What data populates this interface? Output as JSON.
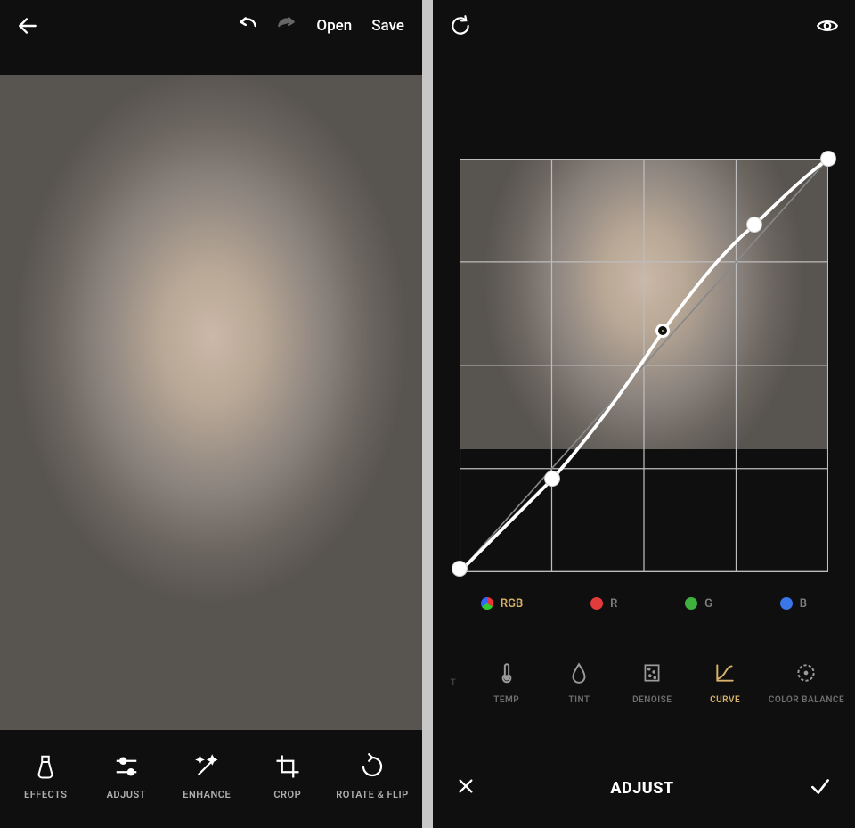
{
  "left": {
    "toolbar": {
      "open_label": "Open",
      "save_label": "Save"
    },
    "tools": [
      {
        "id": "effects",
        "label": "EFFECTS"
      },
      {
        "id": "adjust",
        "label": "ADJUST"
      },
      {
        "id": "enhance",
        "label": "ENHANCE"
      },
      {
        "id": "crop",
        "label": "CROP"
      },
      {
        "id": "rotate",
        "label": "ROTATE & FLIP"
      }
    ]
  },
  "right": {
    "curve_points": [
      {
        "x": 0.0,
        "y": 1.0
      },
      {
        "x": 0.25,
        "y": 0.78
      },
      {
        "x": 0.55,
        "y": 0.42,
        "selected": true
      },
      {
        "x": 0.8,
        "y": 0.16
      },
      {
        "x": 1.0,
        "y": 0.0
      }
    ],
    "channels": [
      {
        "id": "rgb",
        "label": "RGB",
        "active": true
      },
      {
        "id": "r",
        "label": "R"
      },
      {
        "id": "g",
        "label": "G"
      },
      {
        "id": "b",
        "label": "B"
      }
    ],
    "adjust_tools": [
      {
        "id": "left-edge",
        "label": "T"
      },
      {
        "id": "temp",
        "label": "TEMP"
      },
      {
        "id": "tint",
        "label": "TINT"
      },
      {
        "id": "denoise",
        "label": "DENOISE"
      },
      {
        "id": "curve",
        "label": "CURVE",
        "active": true
      },
      {
        "id": "colorbalance",
        "label": "COLOR BALANCE"
      }
    ],
    "panel_title": "ADJUST"
  }
}
